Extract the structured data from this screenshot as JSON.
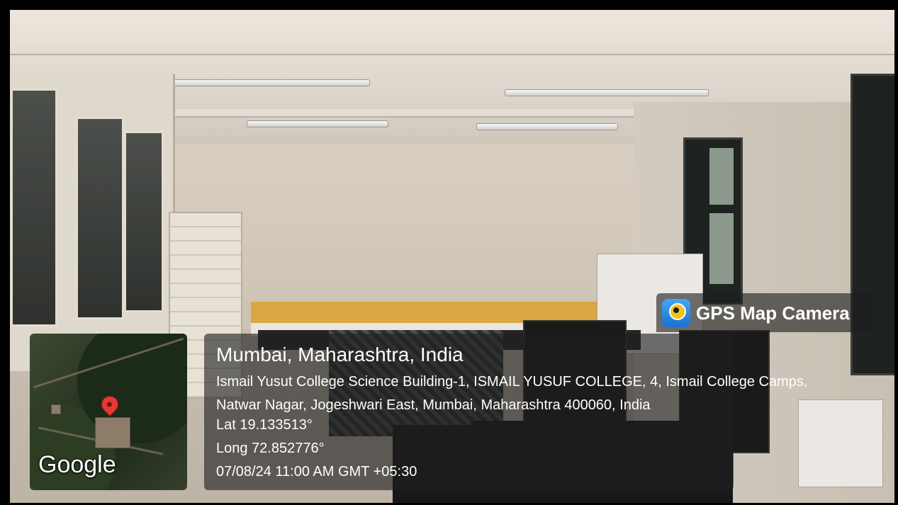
{
  "overlay": {
    "map_logo_text": "Google",
    "app_badge": "GPS Map Camera",
    "city": "Mumbai, Maharashtra, India",
    "address": "Ismail Yusut College Science Building-1, ISMAIL YUSUF COLLEGE, 4, Ismail College Camps, Natwar Nagar, Jogeshwari East, Mumbai, Maharashtra 400060, India",
    "latitude": "Lat 19.133513°",
    "longitude": "Long 72.852776°",
    "datetime": "07/08/24 11:00 AM GMT +05:30"
  },
  "colors": {
    "overlay_bg": "#1e1e1e",
    "pin": "#e53935",
    "badge_icon": "#1d6fd1"
  }
}
